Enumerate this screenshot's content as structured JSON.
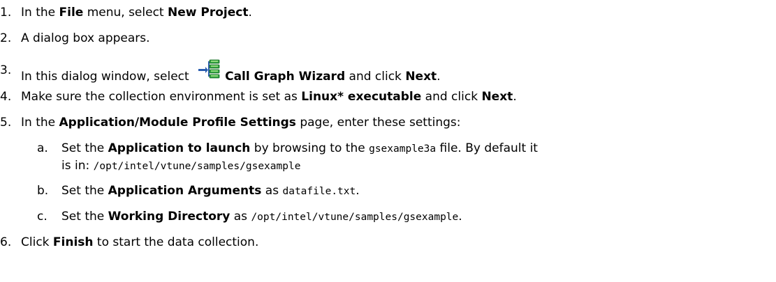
{
  "steps": [
    {
      "num": "1.",
      "parts": {
        "t1": "In the ",
        "b1": "File",
        "t2": " menu, select ",
        "b2": "New Project",
        "t3": "."
      }
    },
    {
      "num": "2.",
      "parts": {
        "t1": "A dialog box appears."
      }
    },
    {
      "num": "3.",
      "icon": "call-graph-wizard-icon",
      "parts": {
        "t1": "In this dialog window, select ",
        "b1": "Call Graph Wizard",
        "t2": " and click ",
        "b2": "Next",
        "t3": "."
      }
    },
    {
      "num": "4.",
      "parts": {
        "t1": "Make sure the collection environment is set as ",
        "b1": "Linux* executable",
        "t2": " and click ",
        "b2": "Next",
        "t3": "."
      }
    },
    {
      "num": "5.",
      "parts": {
        "t1": "In the ",
        "b1": "Application/Module Profile Settings",
        "t2": " page, enter these settings:"
      },
      "substeps": [
        {
          "num": "a.",
          "line1": {
            "t1": "Set the ",
            "b1": "Application to launch",
            "t2": " by browsing to the ",
            "m1": "gsexample3a",
            "t3": " file. By default it"
          },
          "line2": {
            "t1": "is in: ",
            "m1": "/opt/intel/vtune/samples/gsexample"
          }
        },
        {
          "num": "b.",
          "parts": {
            "t1": "Set the ",
            "b1": "Application Arguments",
            "t2": " as ",
            "m1": "datafile.txt",
            "t3": "."
          }
        },
        {
          "num": "c.",
          "parts": {
            "t1": "Set the ",
            "b1": "Working Directory",
            "t2": " as ",
            "m1": "/opt/intel/vtune/samples/gsexample",
            "t3": "."
          }
        }
      ]
    },
    {
      "num": "6.",
      "parts": {
        "t1": "Click ",
        "b1": "Finish",
        "t2": " to start the data collection."
      }
    }
  ],
  "colors": {
    "icon_green": "#2e9e3e",
    "icon_light_green": "#8fdc7a",
    "icon_blue": "#2a5db0"
  }
}
